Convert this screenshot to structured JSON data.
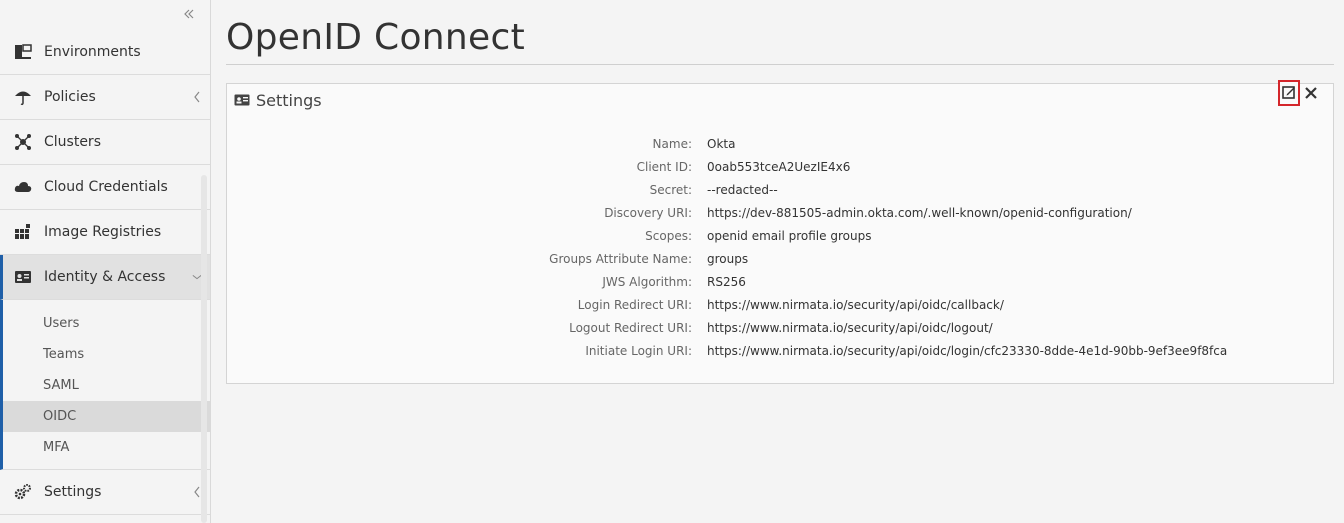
{
  "sidebar": {
    "collapse_icon": "double-chevron-left-icon",
    "items": [
      {
        "label": "Environments",
        "icon": "environments-icon"
      },
      {
        "label": "Policies",
        "icon": "umbrella-icon"
      },
      {
        "label": "Clusters",
        "icon": "clusters-icon"
      },
      {
        "label": "Cloud Credentials",
        "icon": "cloud-icon"
      },
      {
        "label": "Image Registries",
        "icon": "registry-icon"
      },
      {
        "label": "Identity & Access",
        "icon": "id-card-icon"
      },
      {
        "label": "Settings",
        "icon": "gears-icon"
      }
    ],
    "sub_items": [
      {
        "label": "Users"
      },
      {
        "label": "Teams"
      },
      {
        "label": "SAML"
      },
      {
        "label": "OIDC"
      },
      {
        "label": "MFA"
      }
    ]
  },
  "main": {
    "title": "OpenID Connect",
    "panel": {
      "title": "Settings",
      "icon": "id-card-icon",
      "edit_icon": "edit-icon",
      "close_icon": "close-icon",
      "fields": [
        {
          "label": "Name:",
          "value": "Okta"
        },
        {
          "label": "Client ID:",
          "value": "0oab553tceA2UezIE4x6"
        },
        {
          "label": "Secret:",
          "value": "--redacted--"
        },
        {
          "label": "Discovery URI:",
          "value": "https://dev-881505-admin.okta.com/.well-known/openid-configuration/"
        },
        {
          "label": "Scopes:",
          "value": "openid email profile groups"
        },
        {
          "label": "Groups Attribute Name:",
          "value": "groups"
        },
        {
          "label": "JWS Algorithm:",
          "value": "RS256"
        },
        {
          "label": "Login Redirect URI:",
          "value": "https://www.nirmata.io/security/api/oidc/callback/"
        },
        {
          "label": "Logout Redirect URI:",
          "value": "https://www.nirmata.io/security/api/oidc/logout/"
        },
        {
          "label": "Initiate Login URI:",
          "value": "https://www.nirmata.io/security/api/oidc/login/cfc23330-8dde-4e1d-90bb-9ef3ee9f8fca"
        }
      ]
    }
  },
  "colors": {
    "accent": "#1f5fa8",
    "highlight": "#d4262b"
  }
}
